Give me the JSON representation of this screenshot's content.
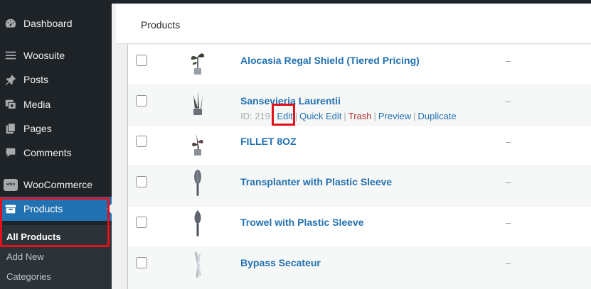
{
  "sidebar": {
    "items": [
      {
        "label": "Dashboard",
        "icon": "dashboard-icon"
      },
      {
        "label": "Woosuite",
        "icon": "woosuite-icon"
      },
      {
        "label": "Posts",
        "icon": "pin-icon"
      },
      {
        "label": "Media",
        "icon": "media-icon"
      },
      {
        "label": "Pages",
        "icon": "pages-icon"
      },
      {
        "label": "Comments",
        "icon": "comments-icon"
      },
      {
        "label": "WooCommerce",
        "icon": "woocommerce-icon",
        "badge": "woo"
      },
      {
        "label": "Products",
        "icon": "products-icon",
        "active": true
      }
    ],
    "submenu": [
      {
        "label": "All Products",
        "current": true
      },
      {
        "label": "Add New"
      },
      {
        "label": "Categories"
      }
    ]
  },
  "header": {
    "title": "Products"
  },
  "products": [
    {
      "name": "Alocasia Regal Shield (Tiered Pricing)",
      "col": "–",
      "thumb": "plant-icon"
    },
    {
      "name": "Sansevieria Laurentii",
      "col": "–",
      "thumb": "snake-plant-icon",
      "actions": {
        "id_label": "ID: 219",
        "edit": "Edit",
        "quick_edit": "Quick Edit",
        "trash": "Trash",
        "preview": "Preview",
        "duplicate": "Duplicate"
      }
    },
    {
      "name": "FILLET 8OZ",
      "col": "–",
      "thumb": "plant-icon"
    },
    {
      "name": "Transplanter with Plastic Sleeve",
      "col": "–",
      "thumb": "trowel-icon"
    },
    {
      "name": "Trowel with Plastic Sleeve",
      "col": "–",
      "thumb": "trowel-icon"
    },
    {
      "name": "Bypass Secateur",
      "col": "–",
      "thumb": "secateur-icon"
    }
  ],
  "colors": {
    "sidebar_bg": "#1d2327",
    "active": "#2271b1",
    "link": "#2271b1",
    "highlight": "#e1111b",
    "trash": "#b32d2e"
  }
}
